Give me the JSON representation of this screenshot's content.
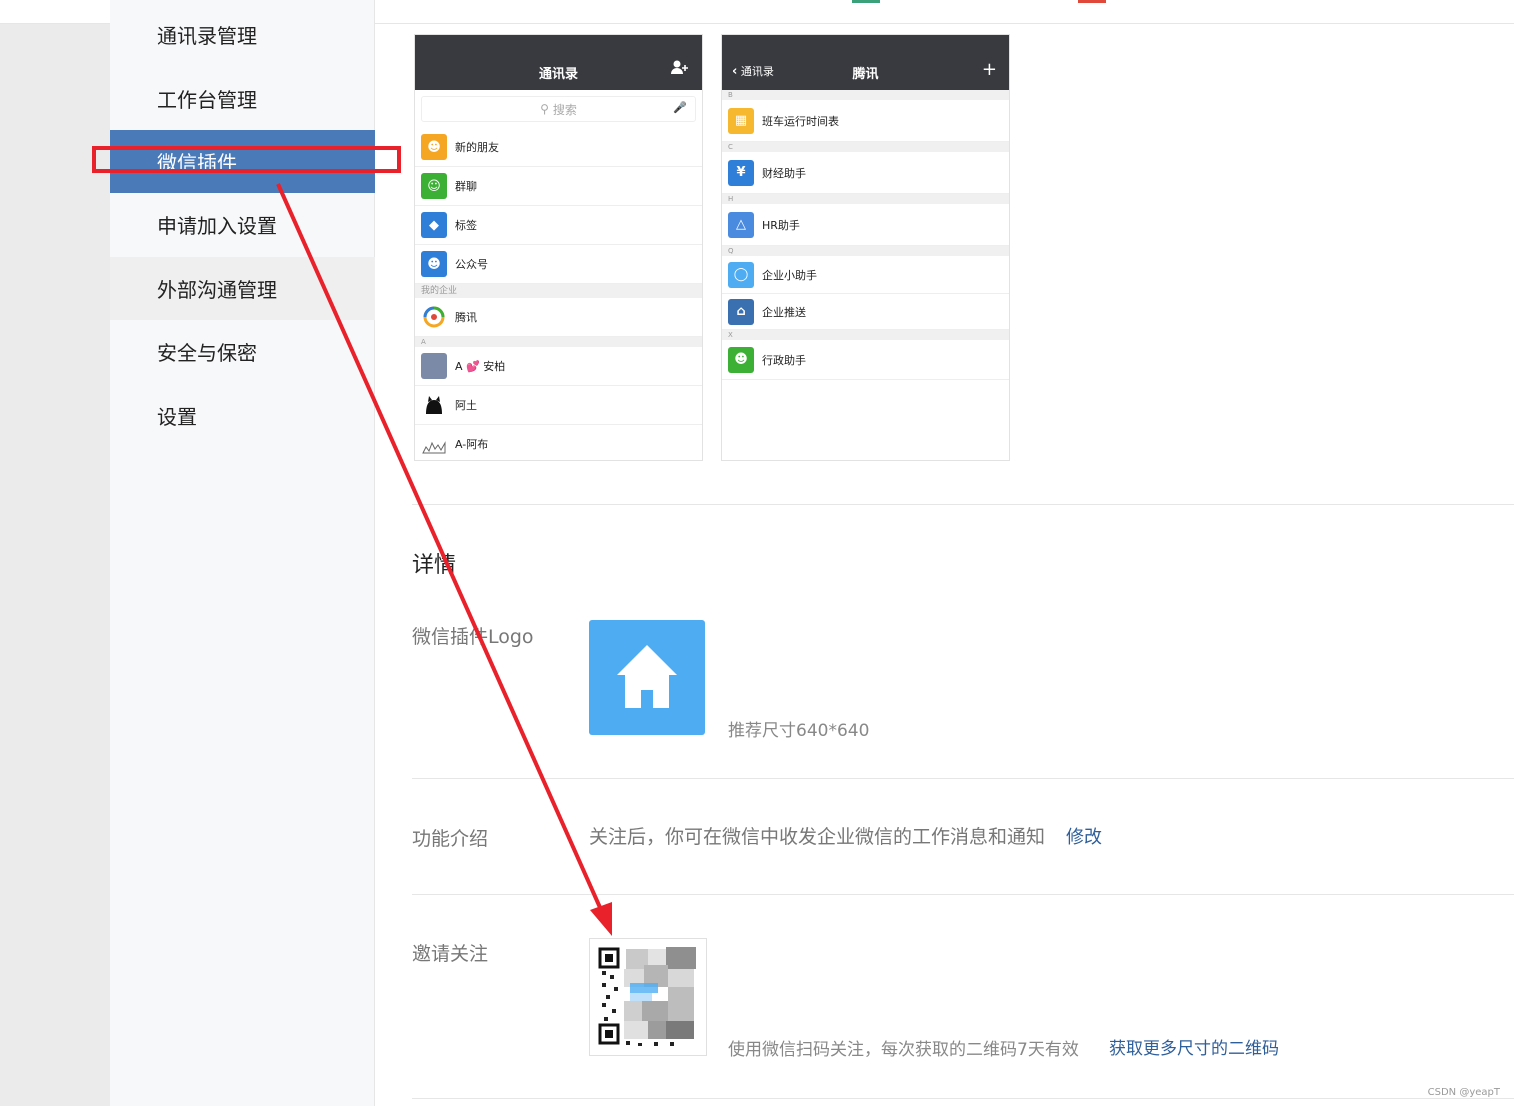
{
  "sidebar": {
    "items": [
      {
        "label": "通讯录管理"
      },
      {
        "label": "工作台管理"
      },
      {
        "label": "微信插件"
      },
      {
        "label": "申请加入设置"
      },
      {
        "label": "外部沟通管理"
      },
      {
        "label": "安全与保密"
      },
      {
        "label": "设置"
      }
    ]
  },
  "phone_left": {
    "title": "通讯录",
    "search_placeholder": "搜索",
    "rows_top": [
      {
        "label": "新的朋友",
        "icon": "add-friend-icon",
        "color": "#f5a623"
      },
      {
        "label": "群聊",
        "icon": "group-icon",
        "color": "#3cb035"
      },
      {
        "label": "标签",
        "icon": "tag-icon",
        "color": "#2f7ed8"
      },
      {
        "label": "公众号",
        "icon": "official-account-icon",
        "color": "#2f7ed8"
      }
    ],
    "section_company": "我的企业",
    "company_row": {
      "label": "腾讯",
      "icon": "tencent-logo-icon"
    },
    "section_a": "A",
    "rows_a": [
      {
        "label": "A 💕 安柏",
        "icon": "avatar"
      },
      {
        "label": "阿土",
        "icon": "avatar"
      },
      {
        "label": "A-阿布",
        "icon": "avatar"
      }
    ]
  },
  "phone_right": {
    "back_label": "通讯录",
    "title": "腾讯",
    "groups": [
      {
        "letter": "B",
        "rows": [
          {
            "label": "班车运行时间表",
            "icon": "bus-icon",
            "color": "#f5b82e"
          }
        ]
      },
      {
        "letter": "C",
        "rows": [
          {
            "label": "财经助手",
            "icon": "yen-icon",
            "color": "#2f7ed8"
          }
        ]
      },
      {
        "letter": "H",
        "rows": [
          {
            "label": "HR助手",
            "icon": "network-icon",
            "color": "#4a8be0"
          }
        ]
      },
      {
        "letter": "Q",
        "rows": [
          {
            "label": "企业小助手",
            "icon": "chat-bubble-icon",
            "color": "#4eacf2"
          },
          {
            "label": "企业推送",
            "icon": "home-icon",
            "color": "#3a6fb0"
          }
        ]
      },
      {
        "letter": "X",
        "rows": [
          {
            "label": "行政助手",
            "icon": "person-icon",
            "color": "#3cb035"
          }
        ]
      }
    ]
  },
  "details": {
    "title": "详情",
    "logo_label": "微信插件Logo",
    "logo_hint": "推荐尺寸640*640",
    "intro_label": "功能介绍",
    "intro_text": "关注后，你可在微信中收发企业微信的工作消息和通知",
    "intro_edit": "修改",
    "invite_label": "邀请关注",
    "invite_hint": "使用微信扫码关注，每次获取的二维码7天有效",
    "invite_link": "获取更多尺寸的二维码"
  },
  "watermark": "CSDN @yeapT",
  "colors": {
    "sidebar_active": "#4a7ab8",
    "annotation_red": "#e8212b",
    "logo_blue": "#4eacf2",
    "link_blue": "#2f5f9a"
  }
}
